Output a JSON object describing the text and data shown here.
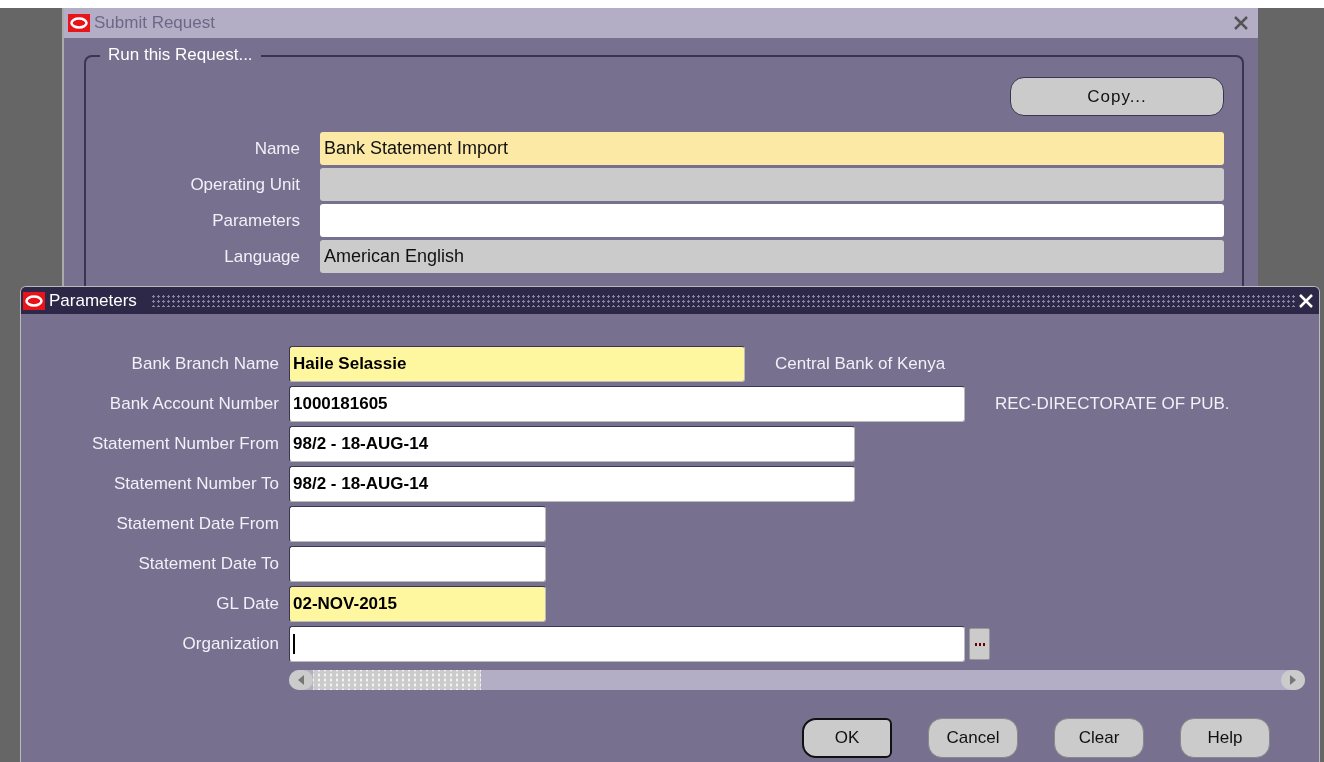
{
  "submit_window": {
    "title": "Submit Request",
    "active": false,
    "section_title": "Run this Request...",
    "copy_button": "Copy...",
    "fields": [
      {
        "label": "Name",
        "value": "Bank Statement Import",
        "kind": "required"
      },
      {
        "label": "Operating Unit",
        "kind": "readonly"
      },
      {
        "label": "Parameters",
        "kind": "normal"
      },
      {
        "label": "Language",
        "value": "American English",
        "kind": "readonly"
      }
    ]
  },
  "parameters_window": {
    "title": "Parameters",
    "active": true,
    "fields": [
      {
        "label": "Bank Branch Name",
        "value": "Haile Selassie",
        "kind": "required",
        "description": "Central Bank of Kenya"
      },
      {
        "label": "Bank Account Number",
        "value": "1000181605",
        "kind": "normal",
        "description": "REC-DIRECTORATE OF PUB."
      },
      {
        "label": "Statement Number From",
        "value": "98/2 - 18-AUG-14",
        "kind": "normal"
      },
      {
        "label": "Statement Number To",
        "value": "98/2 - 18-AUG-14",
        "kind": "normal"
      },
      {
        "label": "Statement Date From",
        "kind": "normal"
      },
      {
        "label": "Statement Date To",
        "kind": "normal"
      },
      {
        "label": "GL Date",
        "value": "02-NOV-2015",
        "kind": "required"
      },
      {
        "label": "Organization",
        "kind": "normal",
        "focused": true,
        "lov": true
      }
    ],
    "buttons": [
      {
        "label": "OK",
        "default": true
      },
      {
        "label": "Cancel",
        "default": false
      },
      {
        "label": "Clear",
        "default": false
      },
      {
        "label": "Help",
        "default": false
      }
    ]
  }
}
